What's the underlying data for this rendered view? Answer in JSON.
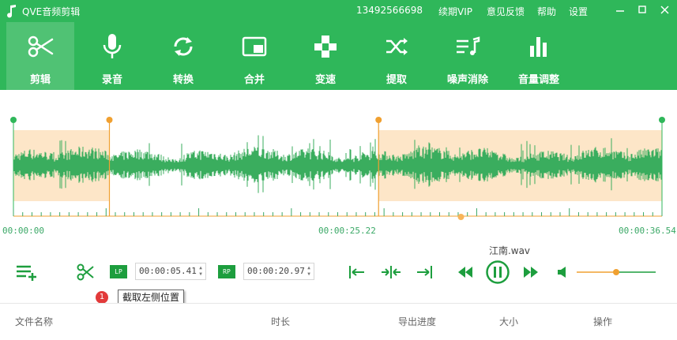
{
  "app": {
    "title": "QVE音频剪辑",
    "phone": "13492566698",
    "renew": "续期VIP",
    "feedback": "意见反馈",
    "help": "帮助",
    "settings": "设置",
    "brand_color": "#2fb75a"
  },
  "toolbar": {
    "items": [
      {
        "label": "剪辑",
        "icon": "scissors-icon",
        "active": true
      },
      {
        "label": "录音",
        "icon": "microphone-icon",
        "active": false
      },
      {
        "label": "转换",
        "icon": "convert-icon",
        "active": false
      },
      {
        "label": "合并",
        "icon": "merge-icon",
        "active": false
      },
      {
        "label": "变速",
        "icon": "speed-icon",
        "active": false
      },
      {
        "label": "提取",
        "icon": "shuffle-icon",
        "active": false
      },
      {
        "label": "噪声消除",
        "icon": "music-list-icon",
        "active": false
      },
      {
        "label": "音量调整",
        "icon": "volume-bars-icon",
        "active": false
      }
    ]
  },
  "timeline": {
    "start": "00:00:00",
    "middle": "00:00:25.22",
    "end": "00:00:36.54",
    "left_cut_fraction": 0.148,
    "right_cut_fraction": 0.563,
    "playhead_fraction": 0.69,
    "waveform_color": "#3aad5e",
    "selection_color": "#fde6c8",
    "marker_color": "#f0a030"
  },
  "controls": {
    "lp_label": "LP",
    "rp_label": "RP",
    "left_time": "00:00:05.41",
    "right_time": "00:00:20.97",
    "filename": "江南.wav",
    "volume_fraction": 0.5
  },
  "tooltip": {
    "number": "1",
    "text": "截取左侧位置"
  },
  "table": {
    "headers": [
      "文件名称",
      "时长",
      "导出进度",
      "大小",
      "操作"
    ]
  }
}
